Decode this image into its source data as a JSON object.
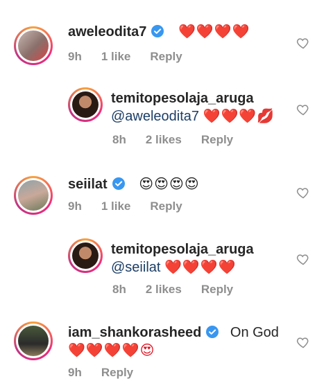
{
  "comments": [
    {
      "username": "aweleodita7",
      "verified": true,
      "text": "❤️❤️❤️❤️",
      "time": "9h",
      "likes": "1 like",
      "reply": "Reply"
    },
    {
      "username": "temitopesolaja_aruga",
      "verified": false,
      "mention": "@aweleodita7",
      "text": "❤️❤️❤️💋",
      "time": "8h",
      "likes": "2 likes",
      "reply": "Reply"
    },
    {
      "username": "seiilat",
      "verified": true,
      "text": "😍😍😍😍",
      "time": "9h",
      "likes": "1 like",
      "reply": "Reply"
    },
    {
      "username": "temitopesolaja_aruga",
      "verified": false,
      "mention": "@seiilat",
      "text": "❤️❤️❤️❤️",
      "time": "8h",
      "likes": "2 likes",
      "reply": "Reply"
    },
    {
      "username": "iam_shankorasheed",
      "verified": true,
      "text": "On God",
      "text2": "❤️❤️❤️❤️😍",
      "time": "9h",
      "reply": "Reply"
    }
  ],
  "colors": {
    "verified": "#3897f0",
    "mention": "#1c3e66",
    "meta": "#8e8e8e"
  }
}
